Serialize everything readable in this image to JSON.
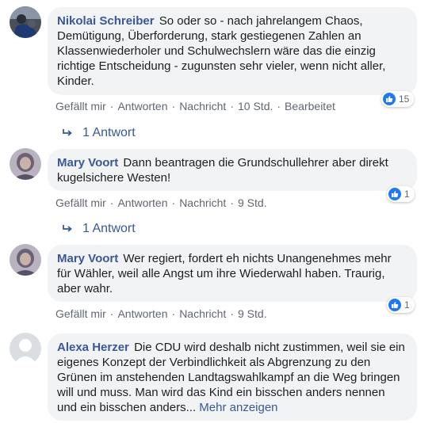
{
  "comments": [
    {
      "author": "Nikolai Schreiber",
      "text": "So oder so - nach jahrelangem Chaos, Demütigung, Überforderung, stark gestiegenen Zahlen an Klassenwiederholer und Schulwechslern wäre das die einzig richtige Entscheidung - zugunsten sehr vieler, wenn nicht aller, Kinder.",
      "reactions": "15",
      "actions": {
        "like": "Gefällt mir",
        "reply": "Antworten",
        "message": "Nachricht",
        "time": "10 Std.",
        "edited": "Bearbeitet"
      },
      "replies": "1 Antwort"
    },
    {
      "author": "Mary Voort",
      "text": "Dann beantragen die Grundschullehrer aber direkt kugelsichere Westen!",
      "reactions": "1",
      "actions": {
        "like": "Gefällt mir",
        "reply": "Antworten",
        "message": "Nachricht",
        "time": "9 Std."
      },
      "replies": "1 Antwort"
    },
    {
      "author": "Mary Voort",
      "text": "Wer regiert, fordert eh nichts Unangenehmes mehr für Wähler, weil alle Angst um ihre Wiederwahl haben. Traurig, aber wahr.",
      "reactions": "1",
      "actions": {
        "like": "Gefällt mir",
        "reply": "Antworten",
        "message": "Nachricht",
        "time": "9 Std."
      }
    },
    {
      "author": "Alexa Herzer",
      "text": "Die CDU wird deshalb nicht zustimmen, weil sie ein eigenes Konzept der Verbindlichkeit als Abgrenzung zu den Grünen im anstehenden Landtagswahlkampf an die Weg bringen will und muss. Man wird das Kind ein bisschen anders nennen und ein bisschen anders...",
      "more": "Mehr anzeigen"
    }
  ],
  "separator": "·",
  "icons": {
    "like": "like-thumb-icon",
    "reply_arrow": "reply-arrow-icon"
  },
  "colors": {
    "link": "#385898",
    "bubble": "#f2f3f5",
    "meta": "#606770",
    "like": "#2078f4"
  }
}
